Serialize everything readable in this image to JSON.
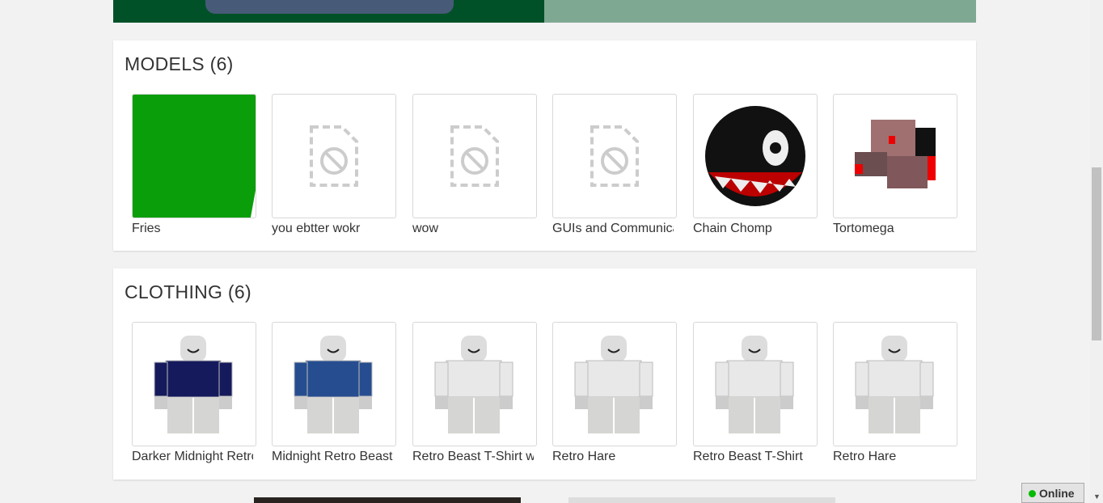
{
  "models": {
    "title": "MODELS (6)",
    "items": [
      {
        "name": "Fries",
        "thumb": "green"
      },
      {
        "name": "you ebtter wokr",
        "thumb": "unavailable"
      },
      {
        "name": "wow",
        "thumb": "unavailable"
      },
      {
        "name": "GUIs and Communication",
        "thumb": "unavailable"
      },
      {
        "name": "Chain Chomp",
        "thumb": "chomp"
      },
      {
        "name": "Tortomega",
        "thumb": "tortomega"
      }
    ]
  },
  "clothing": {
    "title": "CLOTHING (6)",
    "items": [
      {
        "name": "Darker Midnight Retro Beast",
        "shirt": "#151a5c"
      },
      {
        "name": "Midnight Retro Beast T-Shirt",
        "shirt": "#264d8f"
      },
      {
        "name": "Retro Beast T-Shirt white",
        "shirt": "#e8e8e8"
      },
      {
        "name": "Retro Hare",
        "shirt": "#e8e8e8"
      },
      {
        "name": "Retro Beast T-Shirt",
        "shirt": "#e8e8e8"
      },
      {
        "name": "Retro Hare",
        "shirt": "#e8e8e8"
      }
    ]
  },
  "status": {
    "label": "Online",
    "color": "#00bb00"
  }
}
